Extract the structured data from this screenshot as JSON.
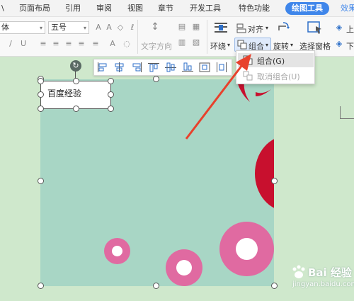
{
  "tabs": [
    {
      "label": "\\",
      "name": "tab-cut"
    },
    {
      "label": "页面布局"
    },
    {
      "label": "引用"
    },
    {
      "label": "审阅"
    },
    {
      "label": "视图"
    },
    {
      "label": "章节"
    },
    {
      "label": "开发工具"
    },
    {
      "label": "特色功能"
    },
    {
      "label": "绘图工具",
      "active": true
    },
    {
      "label": "效果"
    }
  ],
  "ribbon": {
    "font_name": "体",
    "font_size": "五号",
    "text_direction": "文字方向",
    "wrap": "环绕",
    "group": "组合",
    "align": "对齐",
    "rotate": "旋转",
    "selection_pane": "选择窗格",
    "up": "上",
    "down": "下"
  },
  "dropdown": {
    "group_item": "组合(G)",
    "ungroup_item": "取消组合(U)"
  },
  "textbox": {
    "text": "百度经验"
  },
  "watermark": {
    "text": "Bai 经验",
    "url": "jingyan.baidu.com"
  },
  "colors": {
    "canvas_bg": "#a8d6c5",
    "page_bg": "#cfe8cc",
    "pink": "#e06aa1",
    "red": "#c8102e",
    "accent": "#3f86ea",
    "arrow": "#e8412c"
  }
}
